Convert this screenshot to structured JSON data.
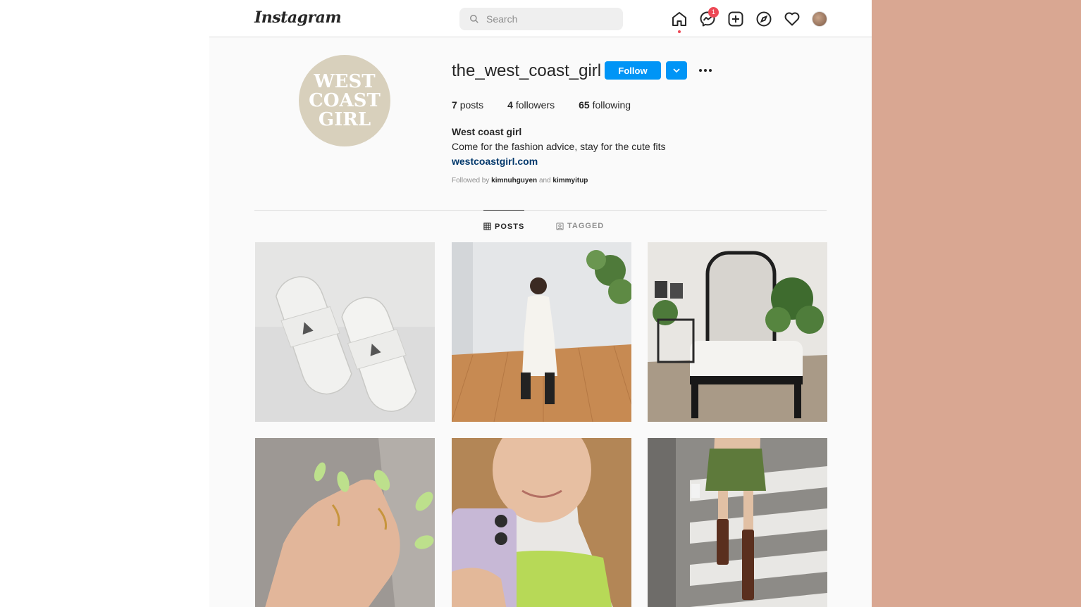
{
  "nav": {
    "logo": "Instagram",
    "search_placeholder": "Search",
    "notification_count": "1",
    "icons": [
      "home-icon",
      "messenger-icon",
      "new-post-icon",
      "explore-icon",
      "activity-heart-icon",
      "profile-avatar"
    ]
  },
  "profile": {
    "avatar_text": [
      "WEST",
      "COAST",
      "GIRL"
    ],
    "username": "the_west_coast_girl",
    "follow_label": "Follow",
    "stats": {
      "posts_count": "7",
      "posts_label": "posts",
      "followers_count": "4",
      "followers_label": "followers",
      "following_count": "65",
      "following_label": "following"
    },
    "full_name": "West coast girl",
    "bio": "Come for the fashion advice, stay for the cute fits",
    "website": "westcoastgirl.com",
    "followed_by_prefix": "Followed by",
    "followed_by_user1": "kimnuhguyen",
    "followed_by_and": "and",
    "followed_by_user2": "kimmyitup"
  },
  "tabs": [
    {
      "label": "POSTS",
      "active": true
    },
    {
      "label": "TAGGED",
      "active": false
    }
  ],
  "posts": [
    {
      "subject": "white heeled mules"
    },
    {
      "subject": "woman seated in white dress"
    },
    {
      "subject": "living room with mirror and plants"
    },
    {
      "subject": "hand with green nails"
    },
    {
      "subject": "mirror selfie with phone"
    },
    {
      "subject": "green skirt and brown boots on crosswalk"
    }
  ],
  "colors": {
    "accent": "#0095f6",
    "background": "#fafafa",
    "side_panel": "#d9a792",
    "badge": "#ed4956",
    "link": "#00376b"
  }
}
